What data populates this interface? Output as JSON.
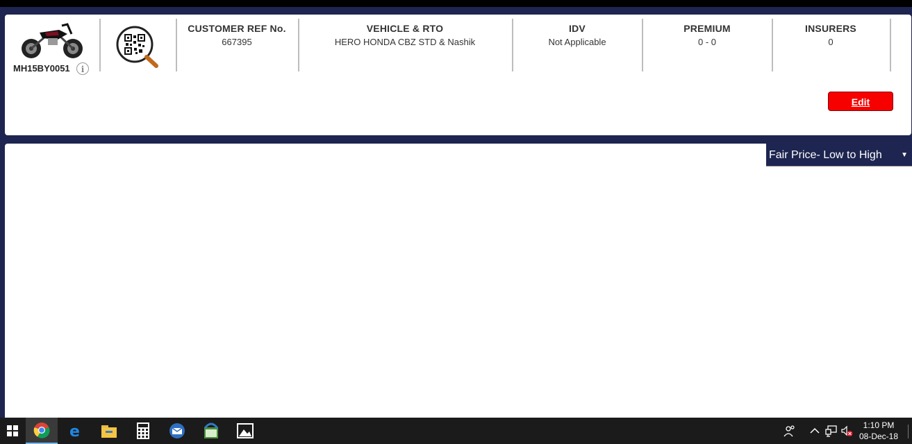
{
  "header": {
    "registration_no": "MH15BY0051",
    "columns": [
      {
        "title": "CUSTOMER REF No.",
        "value": "667395"
      },
      {
        "title": "VEHICLE & RTO",
        "value": "HERO HONDA CBZ STD & Nashik"
      },
      {
        "title": "IDV",
        "value": "Not Applicable"
      },
      {
        "title": "PREMIUM",
        "value": "0 - 0"
      },
      {
        "title": "INSURERS",
        "value": "0"
      }
    ],
    "edit_label": "Edit"
  },
  "sort": {
    "selected": "Fair Price- Low to High",
    "arrow": "▼"
  },
  "colors": {
    "navy": "#1d2550",
    "edit_red": "#f70000"
  },
  "taskbar": {
    "apps": [
      "windows-start-icon",
      "chrome-icon",
      "edge-icon",
      "file-explorer-icon",
      "calculator-icon",
      "outlook-icon",
      "app-icon",
      "photos-icon"
    ],
    "time": "1:10 PM",
    "date": "08-Dec-18"
  }
}
